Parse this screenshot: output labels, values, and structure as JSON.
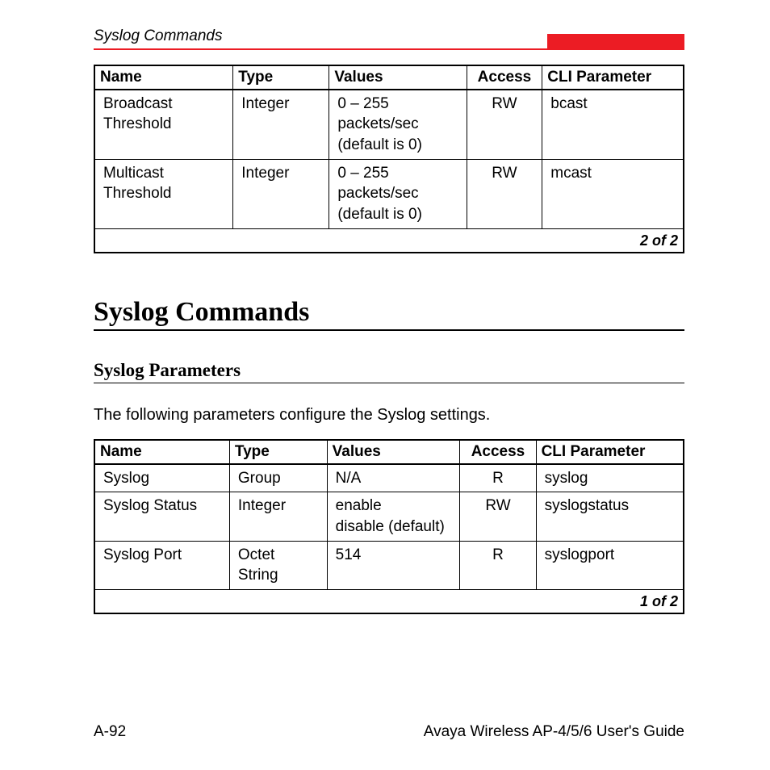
{
  "header": {
    "title": "Syslog Commands"
  },
  "table1": {
    "headers": {
      "name": "Name",
      "type": "Type",
      "values": "Values",
      "access": "Access",
      "cli": "CLI Parameter"
    },
    "rows": [
      {
        "name": "Broadcast Threshold",
        "type": "Integer",
        "values": "0 – 255 packets/sec (default is 0)",
        "access": "RW",
        "cli": "bcast"
      },
      {
        "name": "Multicast Threshold",
        "type": "Integer",
        "values": "0 – 255 packets/sec (default is 0)",
        "access": "RW",
        "cli": "mcast"
      }
    ],
    "pager": "2 of 2"
  },
  "section": {
    "h1": "Syslog Commands",
    "h2": "Syslog Parameters",
    "para": "The following parameters configure the Syslog settings."
  },
  "table2": {
    "headers": {
      "name": "Name",
      "type": "Type",
      "values": "Values",
      "access": "Access",
      "cli": "CLI Parameter"
    },
    "rows": [
      {
        "name": "Syslog",
        "type": "Group",
        "values": "N/A",
        "access": "R",
        "cli": "syslog"
      },
      {
        "name": "Syslog Status",
        "type": "Integer",
        "values": "enable\ndisable (default)",
        "access": "RW",
        "cli": "syslogstatus"
      },
      {
        "name": "Syslog Port",
        "type": "Octet String",
        "values": "514",
        "access": "R",
        "cli": "syslogport"
      }
    ],
    "pager": "1 of 2"
  },
  "footer": {
    "left": "A-92",
    "right": "Avaya Wireless AP-4/5/6 User's Guide"
  }
}
